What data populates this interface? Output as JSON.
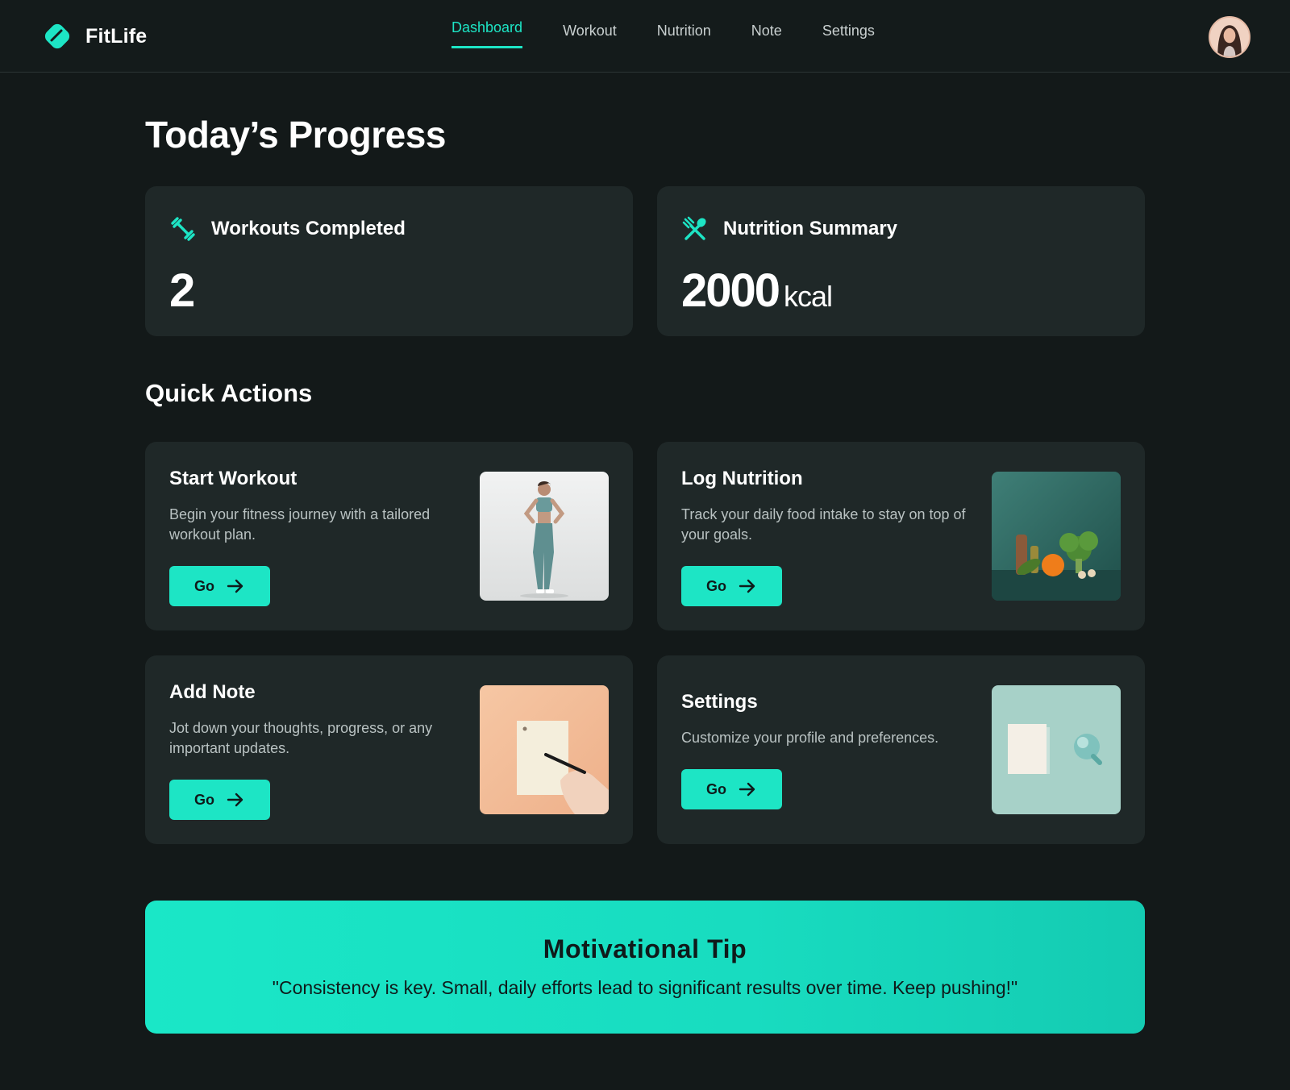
{
  "app": {
    "name": "FitLife"
  },
  "nav": {
    "items": [
      {
        "label": "Dashboard",
        "active": true
      },
      {
        "label": "Workout",
        "active": false
      },
      {
        "label": "Nutrition",
        "active": false
      },
      {
        "label": "Note",
        "active": false
      },
      {
        "label": "Settings",
        "active": false
      }
    ]
  },
  "page": {
    "title": "Today’s Progress"
  },
  "stats": {
    "workouts": {
      "label": "Workouts Completed",
      "value": "2",
      "icon": "dumbbell-icon"
    },
    "nutrition": {
      "label": "Nutrition Summary",
      "value": "2000",
      "unit": "kcal",
      "icon": "fork-knife-icon"
    }
  },
  "quick_actions": {
    "title": "Quick Actions",
    "items": [
      {
        "title": "Start Workout",
        "description": "Begin your fitness journey with a tailored workout plan.",
        "button": "Go",
        "image": "woman-athlete-image"
      },
      {
        "title": "Log Nutrition",
        "description": "Track your daily food intake to stay on top of your goals.",
        "button": "Go",
        "image": "vegetables-image"
      },
      {
        "title": "Add Note",
        "description": "Jot down your thoughts, progress, or any important updates.",
        "button": "Go",
        "image": "hand-writing-note-image"
      },
      {
        "title": "Settings",
        "description": "Customize your profile and preferences.",
        "button": "Go",
        "image": "settings-objects-image"
      }
    ]
  },
  "tip": {
    "title": "Motivational Tip",
    "quote": "\"Consistency is key. Small, daily efforts lead to significant results over time. Keep pushing!\""
  },
  "colors": {
    "accent": "#1de5c5",
    "background": "#131919",
    "card": "#1f2828"
  }
}
